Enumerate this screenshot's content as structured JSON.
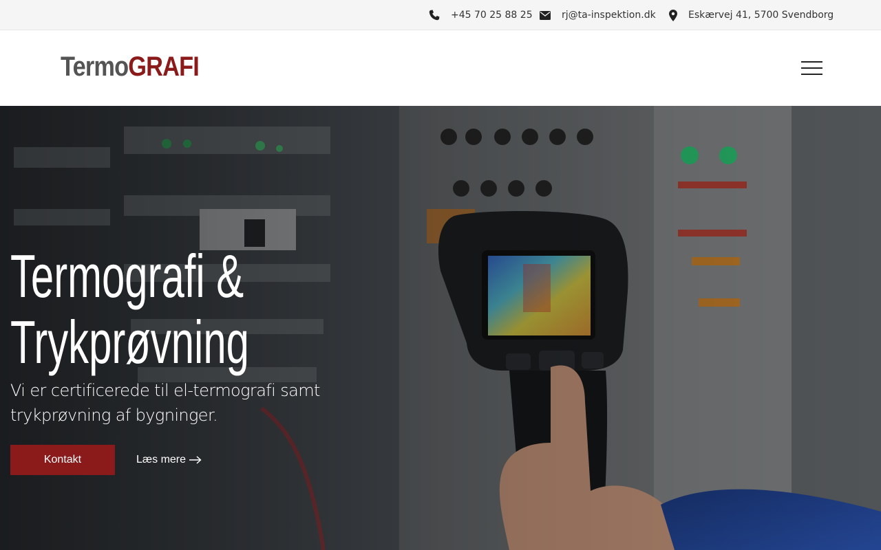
{
  "topbar": {
    "phone": "+45 70 25 88 25",
    "email": "rj@ta-inspektion.dk",
    "address": "Eskærvej 41, 5700 Svendborg",
    "icons": {
      "phone": "phone-icon",
      "email": "envelope-icon",
      "address": "map-marker-icon"
    }
  },
  "header": {
    "logo_part1": "Termo",
    "logo_part2": "GRAFI",
    "menu_icon": "hamburger-menu-icon"
  },
  "hero": {
    "title_line1": "Termografi &",
    "title_line2": "Trykprøvning",
    "subtitle": "Vi er certificerede til el-termografi samt trykprøvning af bygninger.",
    "primary_button": "Kontakt",
    "secondary_link": "Læs mere",
    "secondary_icon": "arrow-right-icon"
  },
  "colors": {
    "brand_red": "#8b1b1b",
    "logo_gray": "#545454",
    "topbar_bg": "#f5f5f5"
  }
}
